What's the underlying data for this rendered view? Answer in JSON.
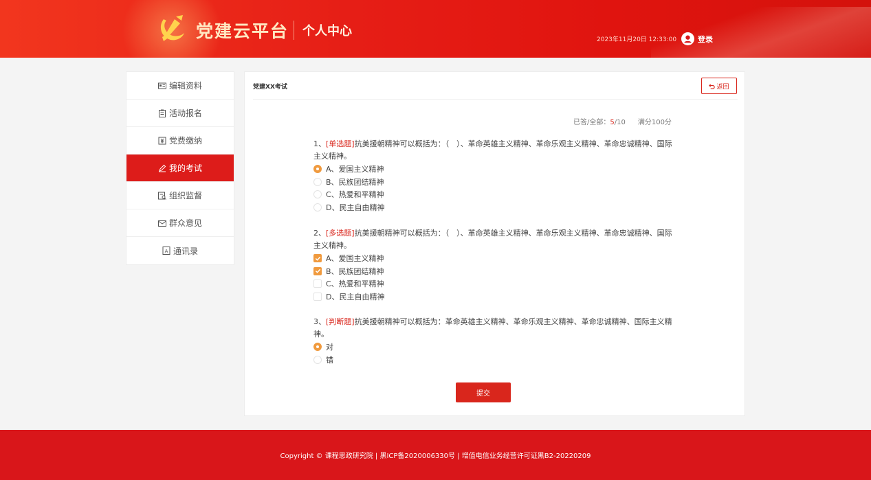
{
  "header": {
    "title": "党建云平台",
    "subtitle": "个人中心",
    "datetime": "2023年11月20日 12:33:00",
    "login_label": "登录"
  },
  "sidebar": {
    "items": [
      {
        "label": "编辑资料",
        "icon": "id-card-icon",
        "active": false
      },
      {
        "label": "活动报名",
        "icon": "clipboard-icon",
        "active": false
      },
      {
        "label": "党费缴纳",
        "icon": "payment-icon",
        "active": false
      },
      {
        "label": "我的考试",
        "icon": "pencil-icon",
        "active": true
      },
      {
        "label": "组织监督",
        "icon": "inspect-icon",
        "active": false
      },
      {
        "label": "群众意见",
        "icon": "mail-icon",
        "active": false
      },
      {
        "label": "通讯录",
        "icon": "contacts-icon",
        "active": false
      }
    ]
  },
  "exam": {
    "title": "党建XX考试",
    "back_label": "返回",
    "stats": {
      "label": "已答/全部：",
      "answered": "5",
      "total": "/10",
      "full_score": "满分100分"
    },
    "questions": [
      {
        "number": "1、",
        "type": "[单选题]",
        "stem": "抗美援朝精神可以概括为：（　）、革命英雄主义精神、革命乐观主义精神、革命忠诚精神、国际主义精神。",
        "input": "radio",
        "options": [
          {
            "label": "A、爱国主义精神",
            "selected": true
          },
          {
            "label": "B、民族团结精神",
            "selected": false
          },
          {
            "label": "C、热爱和平精神",
            "selected": false
          },
          {
            "label": "D、民主自由精神",
            "selected": false
          }
        ]
      },
      {
        "number": "2、",
        "type": "[多选题]",
        "stem": "抗美援朝精神可以概括为：（　）、革命英雄主义精神、革命乐观主义精神、革命忠诚精神、国际主义精神。",
        "input": "checkbox",
        "options": [
          {
            "label": "A、爱国主义精神",
            "selected": true
          },
          {
            "label": "B、民族团结精神",
            "selected": true
          },
          {
            "label": "C、热爱和平精神",
            "selected": false
          },
          {
            "label": "D、民主自由精神",
            "selected": false
          }
        ]
      },
      {
        "number": "3、",
        "type": "[判断题]",
        "stem": "抗美援朝精神可以概括为：革命英雄主义精神、革命乐观主义精神、革命忠诚精神、国际主义精神。",
        "input": "radio",
        "options": [
          {
            "label": "对",
            "selected": true
          },
          {
            "label": "错",
            "selected": false
          }
        ]
      }
    ],
    "submit_label": "提交"
  },
  "footer": {
    "text": "Copyright © 课程思政研究院 | 黑ICP备2020006330号 | 增值电信业务经营许可证黑B2-20220209"
  },
  "colors": {
    "brand_red": "#d9261c",
    "selected_orange": "#f09a3e",
    "header_gold": "#ffe8c2"
  }
}
